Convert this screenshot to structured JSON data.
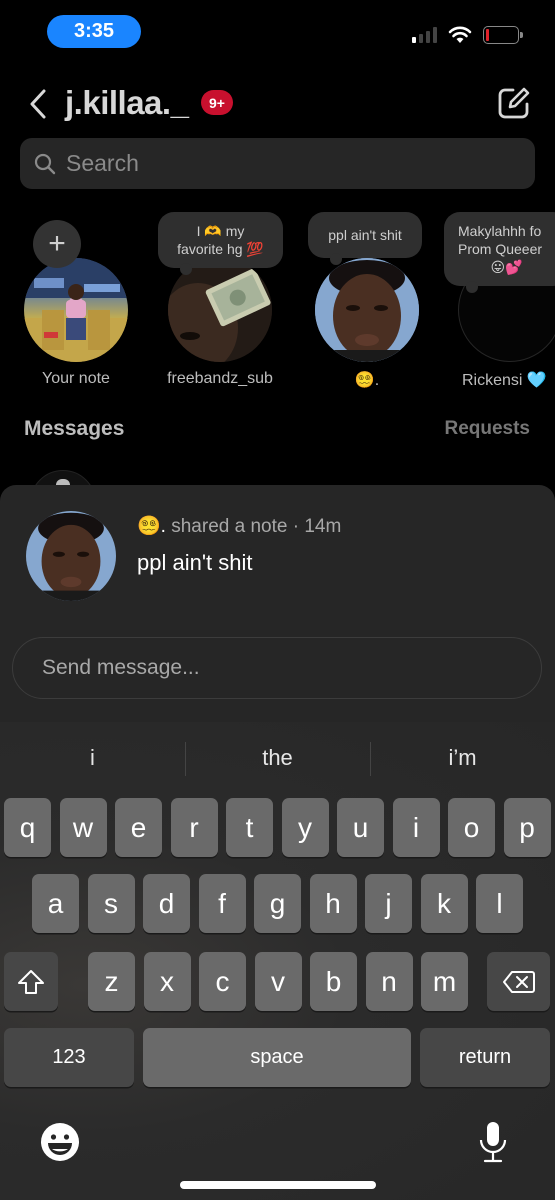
{
  "status_bar": {
    "time": "3:35",
    "signal_bars_active": 1,
    "signal_bars_total": 4,
    "wifi": "wifi-icon",
    "battery_level_percent": 5,
    "battery_color": "#e0222a"
  },
  "header": {
    "username": "j.killaa._",
    "badge": "9+",
    "badge_color": "#c8102e",
    "back_icon": "chevron-left-icon",
    "compose_icon": "compose-icon"
  },
  "search": {
    "placeholder": "Search",
    "value": ""
  },
  "notes": [
    {
      "name": "Your note",
      "bubble": "",
      "has_add": true,
      "add_label": "+"
    },
    {
      "name": "freebandz_sub",
      "bubble_line1": "I 🫶 my",
      "bubble_line2": "favorite hg 💯"
    },
    {
      "name": "😵‍💫.",
      "bubble_line1": "ppl ain't shit"
    },
    {
      "name": "Rickensi 🩵",
      "bubble_line1": "Makylahhh fo",
      "bubble_line2": "Prom Queeer",
      "bubble_line3": "😛💕"
    }
  ],
  "messages_section": {
    "title": "Messages",
    "requests": "Requests"
  },
  "sheet": {
    "author_emoji": "😵‍💫",
    "author_suffix": ".",
    "action": " shared a note · 14m",
    "note_text": "ppl ain't shit",
    "reply_placeholder": "Send message...",
    "reply_value": ""
  },
  "keyboard": {
    "predictions": [
      "i",
      "the",
      "i’m"
    ],
    "row1": [
      "q",
      "w",
      "e",
      "r",
      "t",
      "y",
      "u",
      "i",
      "o",
      "p"
    ],
    "row2": [
      "a",
      "s",
      "d",
      "f",
      "g",
      "h",
      "j",
      "k",
      "l"
    ],
    "row3": [
      "z",
      "x",
      "c",
      "v",
      "b",
      "n",
      "m"
    ],
    "numbers_label": "123",
    "space_label": "space",
    "return_label": "return",
    "shift_icon": "shift-icon",
    "delete_icon": "backspace-icon",
    "emoji_icon": "emoji-icon",
    "mic_icon": "microphone-icon"
  }
}
